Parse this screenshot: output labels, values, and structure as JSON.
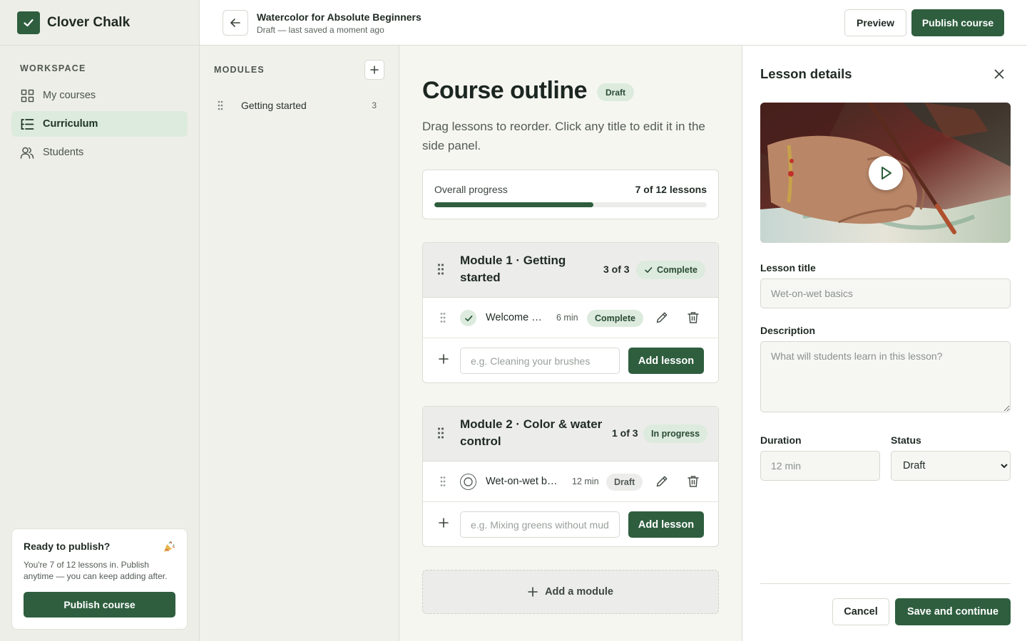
{
  "brand": {
    "name": "Clover Chalk"
  },
  "sidebar": {
    "section_label": "WORKSPACE",
    "items": [
      {
        "label": "My courses",
        "icon": "grid-icon"
      },
      {
        "label": "Curriculum",
        "icon": "list-indent-icon",
        "active": true
      },
      {
        "label": "Students",
        "icon": "users-icon"
      }
    ],
    "publish_card": {
      "title": "Ready to publish?",
      "text": "You're 7 of 12 lessons in. Publish anytime — you can keep adding after.",
      "button": "Publish course"
    }
  },
  "header": {
    "title": "Watercolor for Absolute Beginners",
    "subtitle": "Draft — last saved a moment ago",
    "preview": "Preview",
    "publish": "Publish course"
  },
  "modules_panel": {
    "label": "MODULES",
    "items": [
      {
        "label": "Getting started",
        "count": "3"
      }
    ]
  },
  "main": {
    "title": "Course outline",
    "badge": "Draft",
    "description": "Drag lessons to reorder. Click any title to edit it in the side panel.",
    "progress": {
      "label": "Overall progress",
      "value": "7 of 12 lessons",
      "fraction": 0.583
    },
    "modules": [
      {
        "title": "Module 1 · Getting started",
        "count": "3 of 3",
        "status": "Complete",
        "lessons": [
          {
            "title": "Welcome & course overview",
            "duration": "6 min",
            "badge": "Complete",
            "done": true
          }
        ],
        "add_placeholder": "e.g. Cleaning your brushes",
        "add_button": "Add lesson"
      },
      {
        "title": "Module 2 · Color & water control",
        "count": "1 of 3",
        "status": "In progress",
        "lessons": [
          {
            "title": "Wet-on-wet basics",
            "duration": "12 min",
            "badge": "Draft",
            "done": false
          }
        ],
        "add_placeholder": "e.g. Mixing greens without mud",
        "add_button": "Add lesson"
      }
    ],
    "add_module": "Add a module"
  },
  "lesson_panel": {
    "title": "Lesson details",
    "lesson_title_label": "Lesson title",
    "lesson_title_value": "Wet-on-wet basics",
    "description_label": "Description",
    "description_placeholder": "What will students learn in this lesson?",
    "duration_label": "Duration",
    "duration_value": "12 min",
    "status_label": "Status",
    "status_value": "Draft",
    "cancel": "Cancel",
    "save": "Save and continue"
  },
  "colors": {
    "accent": "#2e5e3e",
    "accent_soft": "#dcebdd"
  }
}
